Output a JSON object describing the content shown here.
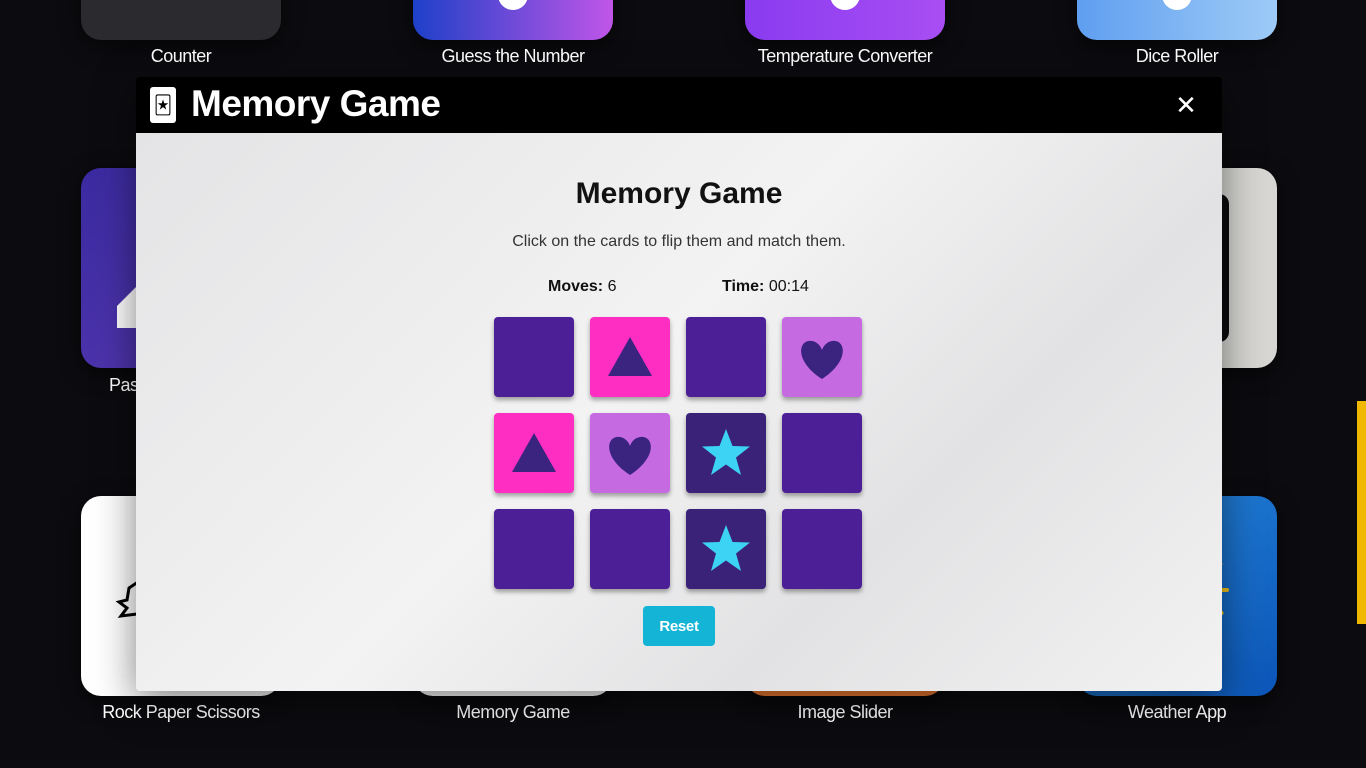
{
  "background_apps": [
    {
      "label": "Counter"
    },
    {
      "label": "Guess the Number"
    },
    {
      "label": "Temperature Converter"
    },
    {
      "label": "Dice Roller"
    },
    {
      "label": "Pass"
    },
    {
      "label": "Rock Paper Scissors"
    },
    {
      "label": "Memory Game"
    },
    {
      "label": "Image Slider"
    },
    {
      "label": "Weather App"
    }
  ],
  "modal": {
    "title": "Memory Game",
    "icon": "joker-card-icon",
    "close_icon": "close-icon"
  },
  "game": {
    "title": "Memory Game",
    "instructions": "Click on the cards to flip them and match them.",
    "moves_label": "Moves:",
    "moves_value": "6",
    "time_label": "Time:",
    "time_value": "00:14",
    "reset_label": "Reset",
    "cards": [
      {
        "state": "face-down",
        "symbol": ""
      },
      {
        "state": "flipped",
        "symbol": "triangle"
      },
      {
        "state": "face-down",
        "symbol": ""
      },
      {
        "state": "flipped",
        "symbol": "heart"
      },
      {
        "state": "flipped",
        "symbol": "triangle"
      },
      {
        "state": "flipped",
        "symbol": "heart"
      },
      {
        "state": "flipped",
        "symbol": "star"
      },
      {
        "state": "face-down",
        "symbol": ""
      },
      {
        "state": "face-down",
        "symbol": ""
      },
      {
        "state": "face-down",
        "symbol": ""
      },
      {
        "state": "flipped",
        "symbol": "star"
      },
      {
        "state": "face-down",
        "symbol": ""
      }
    ]
  },
  "colors": {
    "card_back": "#4c1f96",
    "triangle_card": "#ff2ec3",
    "heart_card": "#c66ae2",
    "star_card": "#3a2278",
    "symbol_dark": "#3a2480",
    "star_symbol": "#3dd3f5",
    "reset_button": "#13b4d6"
  }
}
